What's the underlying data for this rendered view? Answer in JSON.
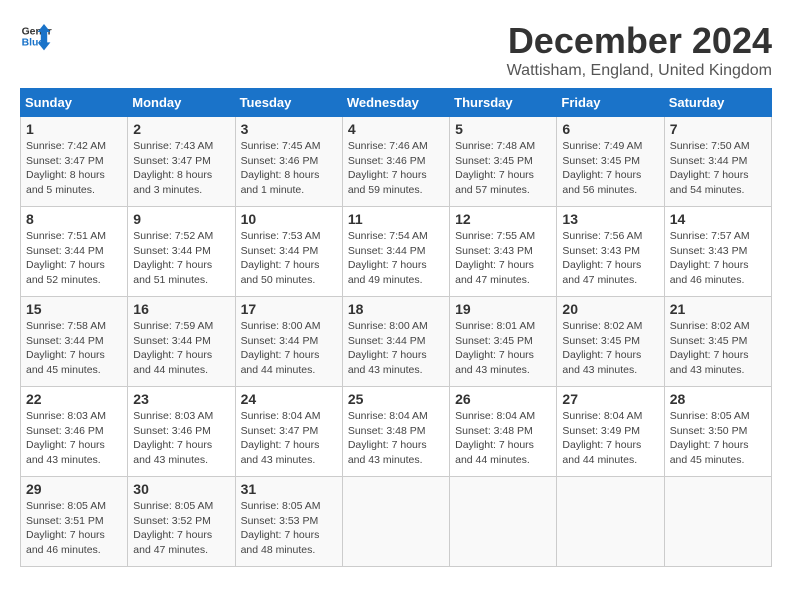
{
  "header": {
    "logo_line1": "General",
    "logo_line2": "Blue",
    "month": "December 2024",
    "location": "Wattisham, England, United Kingdom"
  },
  "days_of_week": [
    "Sunday",
    "Monday",
    "Tuesday",
    "Wednesday",
    "Thursday",
    "Friday",
    "Saturday"
  ],
  "weeks": [
    [
      {
        "num": "1",
        "info": "Sunrise: 7:42 AM\nSunset: 3:47 PM\nDaylight: 8 hours\nand 5 minutes."
      },
      {
        "num": "2",
        "info": "Sunrise: 7:43 AM\nSunset: 3:47 PM\nDaylight: 8 hours\nand 3 minutes."
      },
      {
        "num": "3",
        "info": "Sunrise: 7:45 AM\nSunset: 3:46 PM\nDaylight: 8 hours\nand 1 minute."
      },
      {
        "num": "4",
        "info": "Sunrise: 7:46 AM\nSunset: 3:46 PM\nDaylight: 7 hours\nand 59 minutes."
      },
      {
        "num": "5",
        "info": "Sunrise: 7:48 AM\nSunset: 3:45 PM\nDaylight: 7 hours\nand 57 minutes."
      },
      {
        "num": "6",
        "info": "Sunrise: 7:49 AM\nSunset: 3:45 PM\nDaylight: 7 hours\nand 56 minutes."
      },
      {
        "num": "7",
        "info": "Sunrise: 7:50 AM\nSunset: 3:44 PM\nDaylight: 7 hours\nand 54 minutes."
      }
    ],
    [
      {
        "num": "8",
        "info": "Sunrise: 7:51 AM\nSunset: 3:44 PM\nDaylight: 7 hours\nand 52 minutes."
      },
      {
        "num": "9",
        "info": "Sunrise: 7:52 AM\nSunset: 3:44 PM\nDaylight: 7 hours\nand 51 minutes."
      },
      {
        "num": "10",
        "info": "Sunrise: 7:53 AM\nSunset: 3:44 PM\nDaylight: 7 hours\nand 50 minutes."
      },
      {
        "num": "11",
        "info": "Sunrise: 7:54 AM\nSunset: 3:44 PM\nDaylight: 7 hours\nand 49 minutes."
      },
      {
        "num": "12",
        "info": "Sunrise: 7:55 AM\nSunset: 3:43 PM\nDaylight: 7 hours\nand 47 minutes."
      },
      {
        "num": "13",
        "info": "Sunrise: 7:56 AM\nSunset: 3:43 PM\nDaylight: 7 hours\nand 47 minutes."
      },
      {
        "num": "14",
        "info": "Sunrise: 7:57 AM\nSunset: 3:43 PM\nDaylight: 7 hours\nand 46 minutes."
      }
    ],
    [
      {
        "num": "15",
        "info": "Sunrise: 7:58 AM\nSunset: 3:44 PM\nDaylight: 7 hours\nand 45 minutes."
      },
      {
        "num": "16",
        "info": "Sunrise: 7:59 AM\nSunset: 3:44 PM\nDaylight: 7 hours\nand 44 minutes."
      },
      {
        "num": "17",
        "info": "Sunrise: 8:00 AM\nSunset: 3:44 PM\nDaylight: 7 hours\nand 44 minutes."
      },
      {
        "num": "18",
        "info": "Sunrise: 8:00 AM\nSunset: 3:44 PM\nDaylight: 7 hours\nand 43 minutes."
      },
      {
        "num": "19",
        "info": "Sunrise: 8:01 AM\nSunset: 3:45 PM\nDaylight: 7 hours\nand 43 minutes."
      },
      {
        "num": "20",
        "info": "Sunrise: 8:02 AM\nSunset: 3:45 PM\nDaylight: 7 hours\nand 43 minutes."
      },
      {
        "num": "21",
        "info": "Sunrise: 8:02 AM\nSunset: 3:45 PM\nDaylight: 7 hours\nand 43 minutes."
      }
    ],
    [
      {
        "num": "22",
        "info": "Sunrise: 8:03 AM\nSunset: 3:46 PM\nDaylight: 7 hours\nand 43 minutes."
      },
      {
        "num": "23",
        "info": "Sunrise: 8:03 AM\nSunset: 3:46 PM\nDaylight: 7 hours\nand 43 minutes."
      },
      {
        "num": "24",
        "info": "Sunrise: 8:04 AM\nSunset: 3:47 PM\nDaylight: 7 hours\nand 43 minutes."
      },
      {
        "num": "25",
        "info": "Sunrise: 8:04 AM\nSunset: 3:48 PM\nDaylight: 7 hours\nand 43 minutes."
      },
      {
        "num": "26",
        "info": "Sunrise: 8:04 AM\nSunset: 3:48 PM\nDaylight: 7 hours\nand 44 minutes."
      },
      {
        "num": "27",
        "info": "Sunrise: 8:04 AM\nSunset: 3:49 PM\nDaylight: 7 hours\nand 44 minutes."
      },
      {
        "num": "28",
        "info": "Sunrise: 8:05 AM\nSunset: 3:50 PM\nDaylight: 7 hours\nand 45 minutes."
      }
    ],
    [
      {
        "num": "29",
        "info": "Sunrise: 8:05 AM\nSunset: 3:51 PM\nDaylight: 7 hours\nand 46 minutes."
      },
      {
        "num": "30",
        "info": "Sunrise: 8:05 AM\nSunset: 3:52 PM\nDaylight: 7 hours\nand 47 minutes."
      },
      {
        "num": "31",
        "info": "Sunrise: 8:05 AM\nSunset: 3:53 PM\nDaylight: 7 hours\nand 48 minutes."
      },
      null,
      null,
      null,
      null
    ]
  ]
}
